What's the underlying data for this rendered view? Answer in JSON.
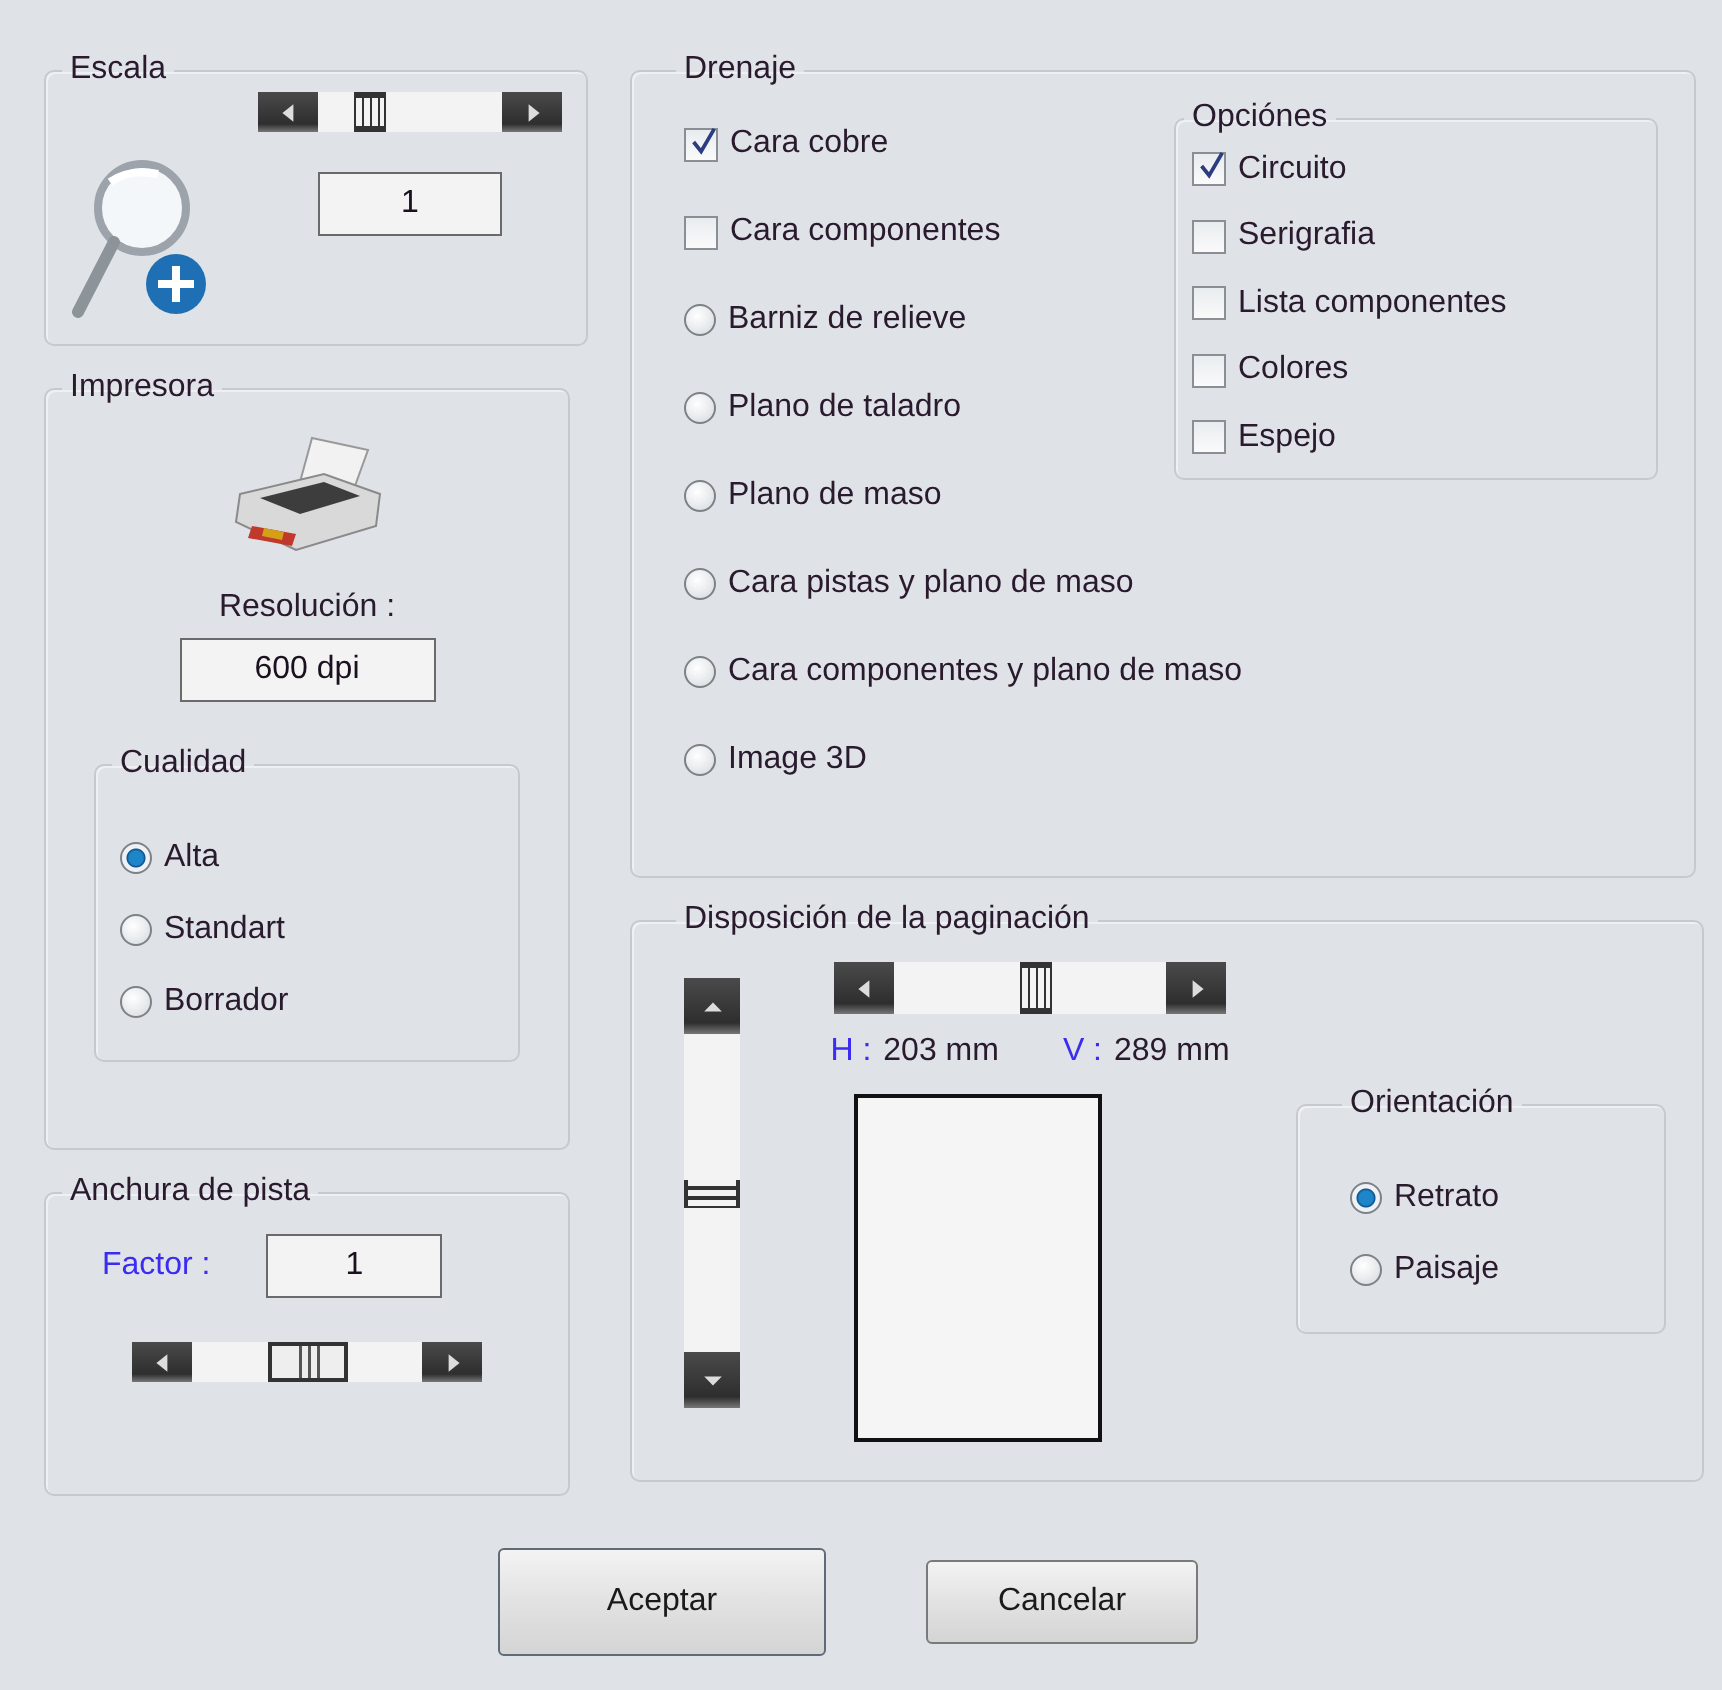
{
  "escala": {
    "title": "Escala",
    "value": "1"
  },
  "impresora": {
    "title": "Impresora",
    "resolution_label": "Resolución :",
    "resolution_value": "600 dpi",
    "quality": {
      "title": "Cualidad",
      "options": [
        {
          "label": "Alta",
          "selected": true
        },
        {
          "label": "Standart",
          "selected": false
        },
        {
          "label": "Borrador",
          "selected": false
        }
      ]
    }
  },
  "anchura": {
    "title": "Anchura de pista",
    "factor_label": "Factor :",
    "factor_value": "1"
  },
  "drenaje": {
    "title": "Drenaje",
    "items": [
      {
        "kind": "checkbox",
        "label": "Cara cobre",
        "checked": true
      },
      {
        "kind": "checkbox",
        "label": "Cara componentes",
        "checked": false
      },
      {
        "kind": "radio",
        "label": "Barniz de relieve",
        "selected": false
      },
      {
        "kind": "radio",
        "label": "Plano de taladro",
        "selected": false
      },
      {
        "kind": "radio",
        "label": "Plano de maso",
        "selected": false
      },
      {
        "kind": "radio",
        "label": "Cara pistas y plano de maso",
        "selected": false
      },
      {
        "kind": "radio",
        "label": "Cara componentes y plano de maso",
        "selected": false
      },
      {
        "kind": "radio",
        "label": "Image 3D",
        "selected": false
      }
    ],
    "opciones": {
      "title": "Opciónes",
      "items": [
        {
          "label": "Circuito",
          "checked": true
        },
        {
          "label": "Serigrafia",
          "checked": false
        },
        {
          "label": "Lista componentes",
          "checked": false
        },
        {
          "label": "Colores",
          "checked": false
        },
        {
          "label": "Espejo",
          "checked": false
        }
      ]
    }
  },
  "paginacion": {
    "title": "Disposición de la paginación",
    "h_label": "H :",
    "h_value": "203 mm",
    "v_label": "V :",
    "v_value": "289 mm",
    "orientation": {
      "title": "Orientación",
      "options": [
        {
          "label": "Retrato",
          "selected": true
        },
        {
          "label": "Paisaje",
          "selected": false
        }
      ]
    }
  },
  "buttons": [
    {
      "label": "Aceptar"
    },
    {
      "label": "Cancelar"
    }
  ]
}
